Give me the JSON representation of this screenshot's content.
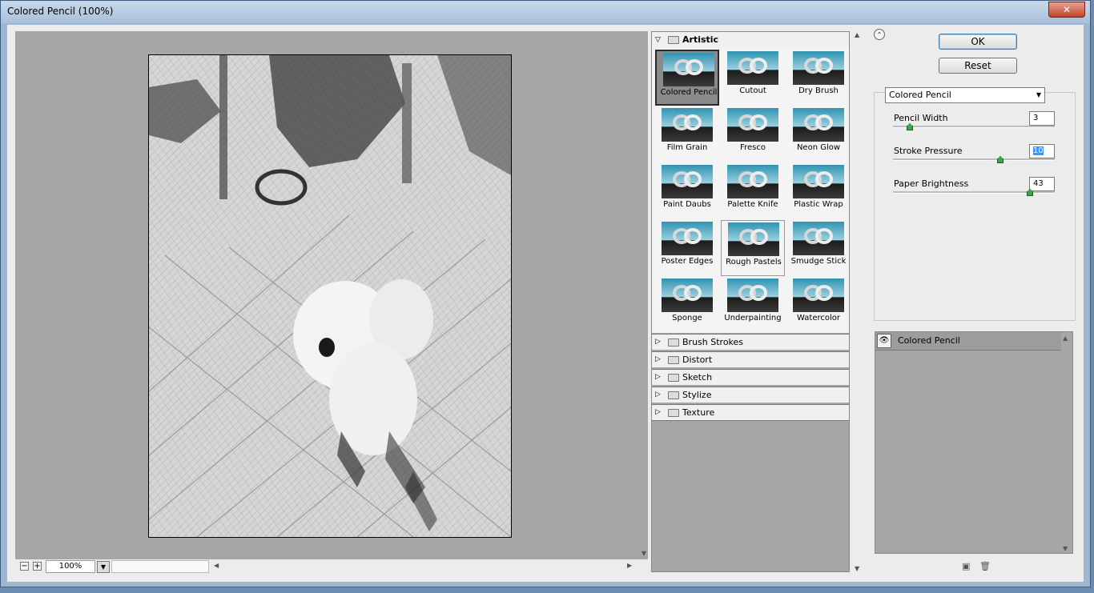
{
  "window": {
    "title": "Colored Pencil (100%)",
    "close": "✕"
  },
  "statusbar": {
    "zoom": "100%",
    "zoom_out": "−",
    "zoom_in": "+"
  },
  "gallery": {
    "open_category": "Artistic",
    "filters": [
      {
        "label": "Colored Pencil",
        "selected": true
      },
      {
        "label": "Cutout"
      },
      {
        "label": "Dry Brush"
      },
      {
        "label": "Film Grain"
      },
      {
        "label": "Fresco"
      },
      {
        "label": "Neon Glow"
      },
      {
        "label": "Paint Daubs"
      },
      {
        "label": "Palette Knife"
      },
      {
        "label": "Plastic Wrap"
      },
      {
        "label": "Poster Edges"
      },
      {
        "label": "Rough Pastels"
      },
      {
        "label": "Smudge Stick"
      },
      {
        "label": "Sponge"
      },
      {
        "label": "Underpainting"
      },
      {
        "label": "Watercolor"
      }
    ],
    "categories": [
      "Brush Strokes",
      "Distort",
      "Sketch",
      "Stylize",
      "Texture"
    ]
  },
  "buttons": {
    "ok": "OK",
    "reset": "Reset"
  },
  "settings": {
    "filter_select": "Colored Pencil",
    "params": [
      {
        "label": "Pencil Width",
        "value": "3",
        "fraction": 0.09
      },
      {
        "label": "Stroke Pressure",
        "value": "10",
        "fraction": 0.67
      },
      {
        "label": "Paper Brightness",
        "value": "43",
        "fraction": 0.86
      }
    ]
  },
  "layers": {
    "items": [
      {
        "label": "Colored Pencil"
      }
    ]
  },
  "colors": {
    "preview_bg": "#a6a6a6",
    "panel_bg": "#ececec",
    "accent": "#3399ff"
  }
}
